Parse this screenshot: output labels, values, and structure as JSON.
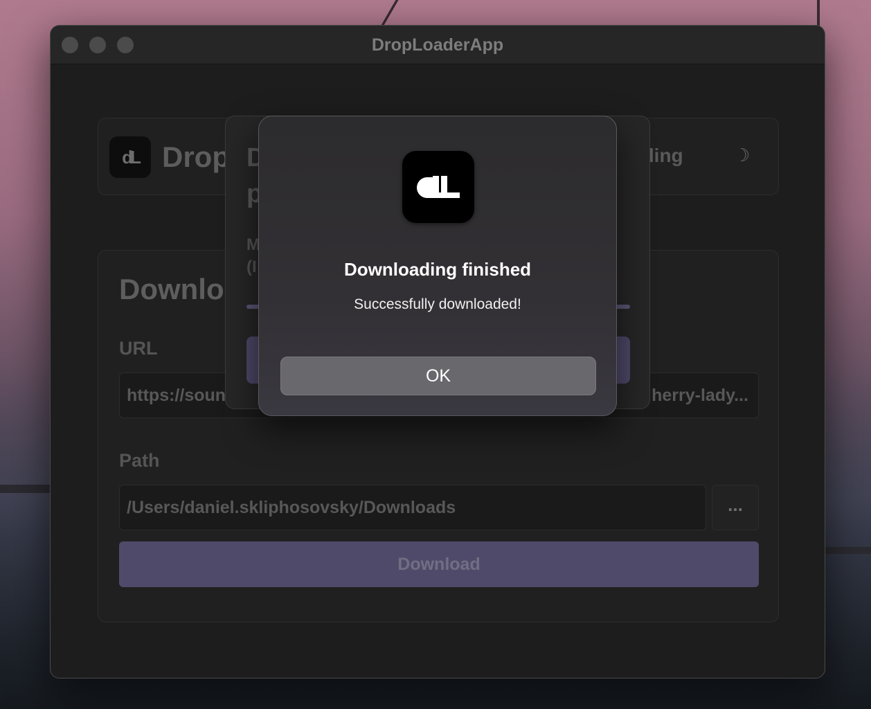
{
  "window": {
    "title": "DropLoaderApp"
  },
  "header": {
    "app_name": "Drop",
    "status_text": "ading",
    "theme_icon": "moon-icon",
    "logo_mark": "dL"
  },
  "download_form": {
    "section_title": "Downlo",
    "url_label": "URL",
    "url_value_start": "https://soun",
    "url_value_end": "herry-lady...",
    "path_label": "Path",
    "path_value": "/Users/daniel.skliphosovsky/Downloads",
    "browse_label": "...",
    "download_label": "Download"
  },
  "progress_sheet": {
    "title_line1": "D",
    "title_line2": "p",
    "message_line1": "M",
    "message_line2": "(I",
    "progress": 1.0
  },
  "alert": {
    "title": "Downloading finished",
    "message": "Successfully downloaded!",
    "ok_label": "OK",
    "icon": "droploader-app-icon"
  },
  "colors": {
    "accent": "#504a6a",
    "alert_button": "#69686d"
  }
}
